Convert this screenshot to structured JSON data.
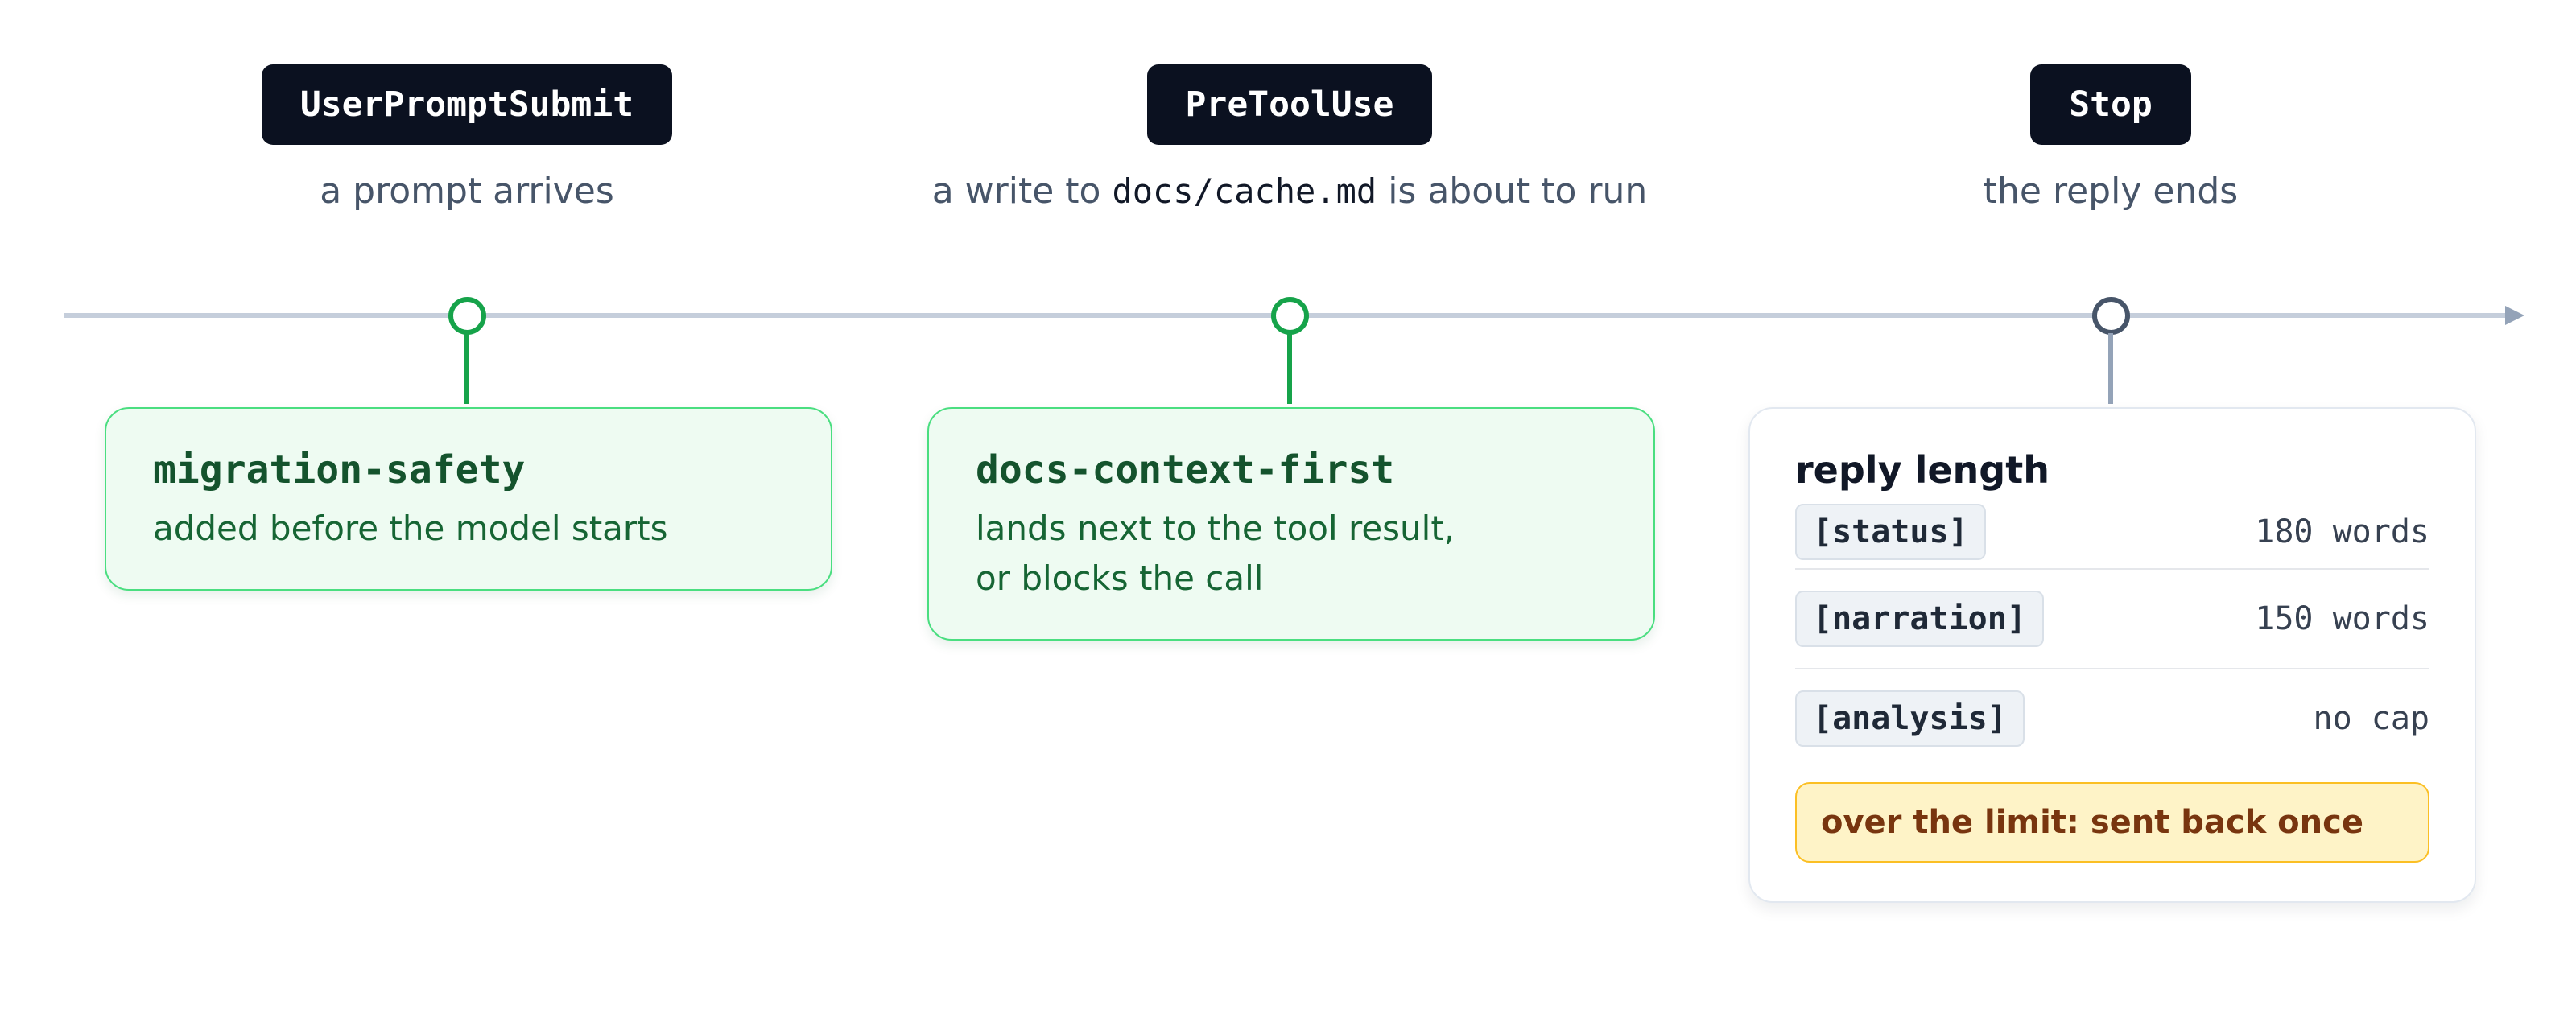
{
  "events": [
    {
      "name": "UserPromptSubmit",
      "caption": "a prompt arrives"
    },
    {
      "name": "PreToolUse",
      "caption_before": "a write to",
      "caption_code": "docs/cache.md",
      "caption_after": "is about to run"
    },
    {
      "name": "Stop",
      "caption": "the reply ends"
    }
  ],
  "cards": {
    "migration": {
      "title": "migration-safety",
      "text": "added before the model starts"
    },
    "docs": {
      "title": "docs-context-first",
      "line1": "lands next to the tool result,",
      "line2": "or blocks the call"
    },
    "reply_length": {
      "title": "reply length",
      "rows": [
        {
          "tag": "[status]",
          "limit": "180 words"
        },
        {
          "tag": "[narration]",
          "limit": "150 words"
        },
        {
          "tag": "[analysis]",
          "limit": "no cap"
        }
      ],
      "warning": "over the limit: sent back once"
    }
  },
  "colors": {
    "badge_bg": "#0b1120",
    "active_node": "#16a34a",
    "inactive_node": "#475569",
    "green_card_bg": "#eefbf2",
    "warning_bg": "#fef3c7"
  }
}
